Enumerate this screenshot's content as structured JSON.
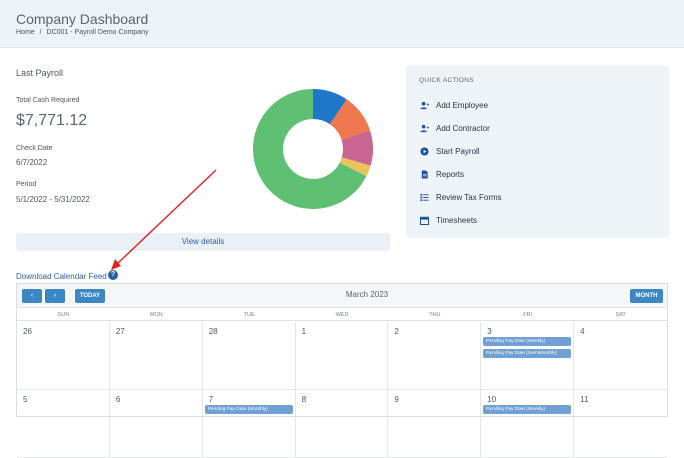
{
  "header": {
    "title": "Company Dashboard",
    "breadcrumb": [
      "Home",
      "/",
      "DC001 - Payroll Demo Company"
    ]
  },
  "last_payroll": {
    "title": "Last Payroll",
    "total_cash_label": "Total Cash Required",
    "total_cash_value": "$7,771.12",
    "check_date_label": "Check Date",
    "check_date_value": "6/7/2022",
    "period_label": "Period",
    "period_value": "5/1/2022 - 5/31/2022",
    "view_details": "View details",
    "donut": {
      "segments": [
        {
          "fraction": 0.095,
          "color": "#1f77c9"
        },
        {
          "fraction": 0.105,
          "color": "#f0784e"
        },
        {
          "fraction": 0.095,
          "color": "#c9658f"
        },
        {
          "fraction": 0.03,
          "color": "#e8c45a"
        },
        {
          "fraction": 0.675,
          "color": "#5fbf72"
        }
      ]
    }
  },
  "quick_actions": {
    "title": "QUICK ACTIONS",
    "items": [
      {
        "label": "Add Employee",
        "icon": "add-user-icon"
      },
      {
        "label": "Add Contractor",
        "icon": "add-contractor-icon"
      },
      {
        "label": "Start Payroll",
        "icon": "play-circle-icon"
      },
      {
        "label": "Reports",
        "icon": "document-icon"
      },
      {
        "label": "Review Tax Forms",
        "icon": "list-icon"
      },
      {
        "label": "Timesheets",
        "icon": "calendar-icon"
      }
    ]
  },
  "calendar_feed": {
    "link": "Download Calendar Feed",
    "help": "?"
  },
  "calendar": {
    "prev": "‹",
    "next": "›",
    "today": "TODAY",
    "month_label": "March 2023",
    "view": "MONTH",
    "weekdays": [
      "SUN",
      "MON",
      "TUE",
      "WED",
      "THU",
      "FRI",
      "SAT"
    ],
    "days": [
      {
        "num": "26",
        "events": []
      },
      {
        "num": "27",
        "events": []
      },
      {
        "num": "28",
        "events": []
      },
      {
        "num": "1",
        "events": []
      },
      {
        "num": "2",
        "events": []
      },
      {
        "num": "3",
        "events": [
          "Pending Pay Date (Weekly)",
          "Pending Pay Date (SemiMonthly)"
        ]
      },
      {
        "num": "4",
        "events": []
      },
      {
        "num": "5",
        "events": []
      },
      {
        "num": "6",
        "events": []
      },
      {
        "num": "7",
        "events": [
          "Pending Pay Date (Monthly)"
        ]
      },
      {
        "num": "8",
        "events": []
      },
      {
        "num": "9",
        "events": []
      },
      {
        "num": "10",
        "events": [
          "Pending Pay Date (Weekly)"
        ]
      },
      {
        "num": "11",
        "events": []
      }
    ]
  },
  "colors": {
    "accent": "#3b87c4",
    "link": "#2b5ea8",
    "event": "#6f9fd3",
    "annotation_arrow": "#e02424"
  }
}
